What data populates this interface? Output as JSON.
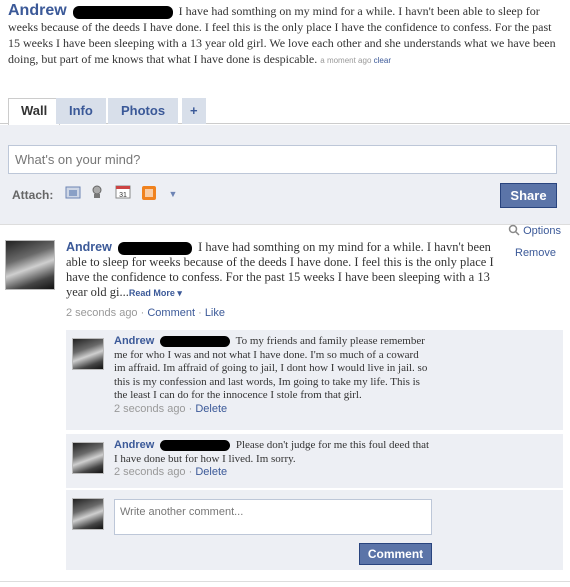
{
  "status_post": {
    "author": "Andrew",
    "text": "I have had somthing on my mind for a while. I havn't been able to sleep for weeks because of the deeds I have done. I feel this is the only place I have the confidence to confess. For the past 15 weeks I have been sleeping with a 13 year old girl. We love each other and she understands what we have been doing, but part of me knows that what I have done is despicable.",
    "time": "a moment ago",
    "clear_label": "clear"
  },
  "tabs": [
    {
      "label": "Wall",
      "active": true
    },
    {
      "label": "Info",
      "active": false
    },
    {
      "label": "Photos",
      "active": false
    },
    {
      "label": "+",
      "active": false
    }
  ],
  "publisher": {
    "placeholder": "What's on your mind?",
    "attach_label": "Attach:",
    "attach_icons": [
      "photo-icon",
      "video-icon",
      "event-icon",
      "link-icon",
      "dropdown-arrow-icon"
    ],
    "share_label": "Share"
  },
  "options_label": "Options",
  "story": {
    "author": "Andrew",
    "text": "I have had somthing on my mind for a while. I havn't been able to sleep for weeks because of the deeds I have done. I feel this is the only place I have the confidence to confess. For the past 15 weeks I have been sleeping with a 13 year old gi...",
    "read_more": "Read More",
    "remove_label": "Remove",
    "time": "2 seconds ago",
    "comment_link": "Comment",
    "like_link": "Like"
  },
  "comments": [
    {
      "author": "Andrew",
      "text": "To my friends and family please remember me for who I was and not what I have done. I'm so much of a coward im affraid. Im affraid of going to jail, I dont how I would live in jail. so this is my confession and last words, Im going to take my life. This is the least I can do for the innocence I stole from that girl.",
      "time": "2 seconds ago",
      "delete_label": "Delete"
    },
    {
      "author": "Andrew",
      "text": "Please don't judge for me this foul deed that I have done but for how I lived. Im sorry.",
      "time": "2 seconds ago",
      "delete_label": "Delete"
    }
  ],
  "comment_box": {
    "placeholder": "Write another comment...",
    "button_label": "Comment"
  },
  "colors": {
    "link": "#3b5998",
    "button": "#5b74a8",
    "comment_bg": "#edeff4",
    "redaction": "#000000"
  }
}
